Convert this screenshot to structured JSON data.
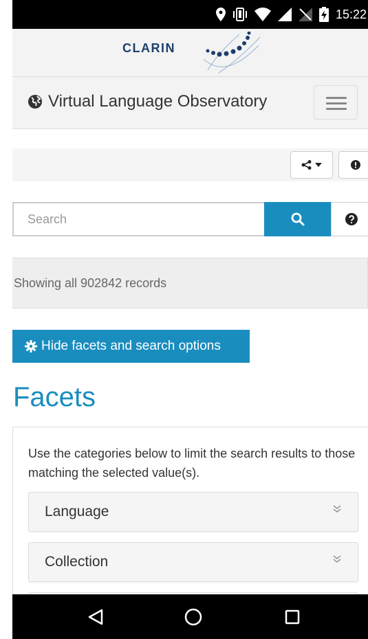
{
  "status_bar": {
    "time": "15:22",
    "icons": [
      "location-icon",
      "vibrate-icon",
      "wifi-icon",
      "signal-icon",
      "no-sim-icon",
      "battery-charging-icon"
    ]
  },
  "brand": {
    "name": "CLARIN",
    "logo_color": "#1d3f6e"
  },
  "navbar": {
    "title": "Virtual Language Observatory",
    "title_icon": "globe-icon",
    "menu_icon": "hamburger-icon"
  },
  "toolbar": {
    "share_icon": "share-icon",
    "share_caret_icon": "caret-down-icon",
    "info_icon": "exclamation-circle-icon"
  },
  "search": {
    "placeholder": "Search",
    "value": "",
    "button_icon": "search-icon",
    "help_icon": "question-circle-icon"
  },
  "records": {
    "text": "Showing all 902842 records"
  },
  "facets_toggle": {
    "label": "Hide facets and search options",
    "icon": "gear-icon"
  },
  "facets": {
    "heading": "Facets",
    "help_text": "Use the categories below to limit the search results to those matching the selected value(s).",
    "items": [
      {
        "label": "Language"
      },
      {
        "label": "Collection"
      }
    ]
  },
  "colors": {
    "accent": "#1a8dbf",
    "brand_text": "#1d3f6e"
  }
}
